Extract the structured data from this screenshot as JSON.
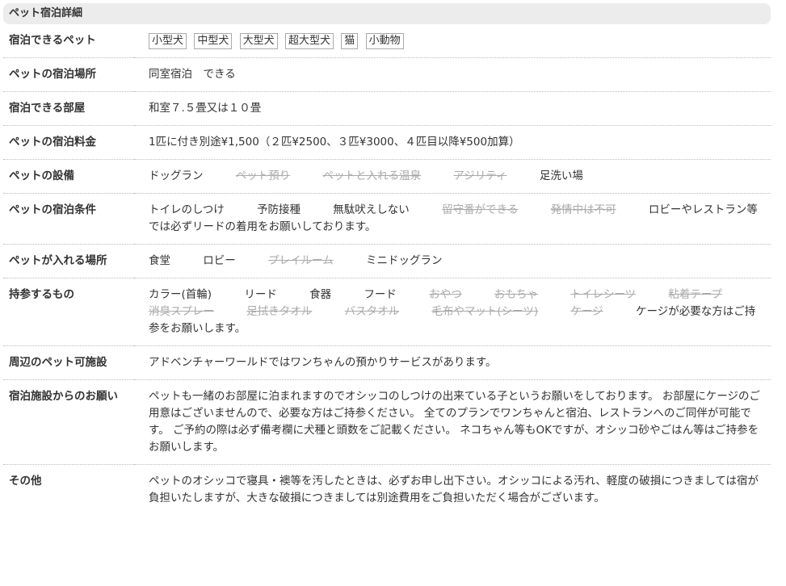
{
  "header": {
    "title": "ペット宿泊詳細"
  },
  "rows": {
    "pets": {
      "label": "宿泊できるペット",
      "tags": [
        "小型犬",
        "中型犬",
        "大型犬",
        "超大型犬",
        "猫",
        "小動物"
      ]
    },
    "place": {
      "label": "ペットの宿泊場所",
      "value": "同室宿泊　できる"
    },
    "room": {
      "label": "宿泊できる部屋",
      "value": "和室７.５畳又は１０畳"
    },
    "fee": {
      "label": "ペットの宿泊料金",
      "value": "1匹に付き別途¥1,500（２匹¥2500、３匹¥3000、４匹目以降¥500加算）"
    },
    "facilities": {
      "label": "ペットの設備",
      "items": [
        {
          "text": "ドッグラン",
          "available": true
        },
        {
          "text": "ペット預り",
          "available": false
        },
        {
          "text": "ペットと入れる温泉",
          "available": false
        },
        {
          "text": "アジリティ",
          "available": false
        },
        {
          "text": "足洗い場",
          "available": true
        }
      ]
    },
    "conditions": {
      "label": "ペットの宿泊条件",
      "items": [
        {
          "text": "トイレのしつけ",
          "available": true
        },
        {
          "text": "予防接種",
          "available": true
        },
        {
          "text": "無駄吠えしない",
          "available": true
        },
        {
          "text": "留守番ができる",
          "available": false
        },
        {
          "text": "発情中は不可",
          "available": false
        }
      ],
      "note": "ロビーやレストラン等では必ずリードの着用をお願いしております。"
    },
    "areas": {
      "label": "ペットが入れる場所",
      "items": [
        {
          "text": "食堂",
          "available": true
        },
        {
          "text": "ロビー",
          "available": true
        },
        {
          "text": "プレイルーム",
          "available": false
        },
        {
          "text": "ミニドッグラン",
          "available": true
        }
      ]
    },
    "bring": {
      "label": "持参するもの",
      "items": [
        {
          "text": "カラー(首輪)",
          "available": true
        },
        {
          "text": "リード",
          "available": true
        },
        {
          "text": "食器",
          "available": true
        },
        {
          "text": "フード",
          "available": true
        },
        {
          "text": "おやつ",
          "available": false
        },
        {
          "text": "おもちゃ",
          "available": false
        },
        {
          "text": "トイレシーツ",
          "available": false
        },
        {
          "text": "粘着テープ",
          "available": false
        },
        {
          "text": "消臭スプレー",
          "available": false
        },
        {
          "text": "足拭きタオル",
          "available": false
        },
        {
          "text": "バスタオル",
          "available": false
        },
        {
          "text": "毛布やマット(シーツ)",
          "available": false
        },
        {
          "text": "ケージ",
          "available": false
        }
      ],
      "note": "ケージが必要な方はご持参をお願いします。"
    },
    "nearby": {
      "label": "周辺のペット可施設",
      "value": "アドベンチャーワールドではワンちゃんの預かりサービスがあります。"
    },
    "request": {
      "label": "宿泊施設からのお願い",
      "value": "ペットも一緒のお部屋に泊まれますのでオシッコのしつけの出来ている子というお願いをしております。 お部屋にケージのご用意はございませんので、必要な方はご持参ください。 全てのプランでワンちゃんと宿泊、レストランへのご同伴が可能です。 ご予約の際は必ず備考欄に犬種と頭数をご記載ください。 ネコちゃん等もOKですが、オシッコ砂やごはん等はご持参をお願いします。"
    },
    "other": {
      "label": "その他",
      "value": "ペットのオシッコで寝具・襖等を汚したときは、必ずお申し出下さい。オシッコによる汚れ、軽度の破損につきましては宿が負担いたしますが、大きな破損につきましては別途費用をご負担いただく場合がございます。"
    }
  }
}
